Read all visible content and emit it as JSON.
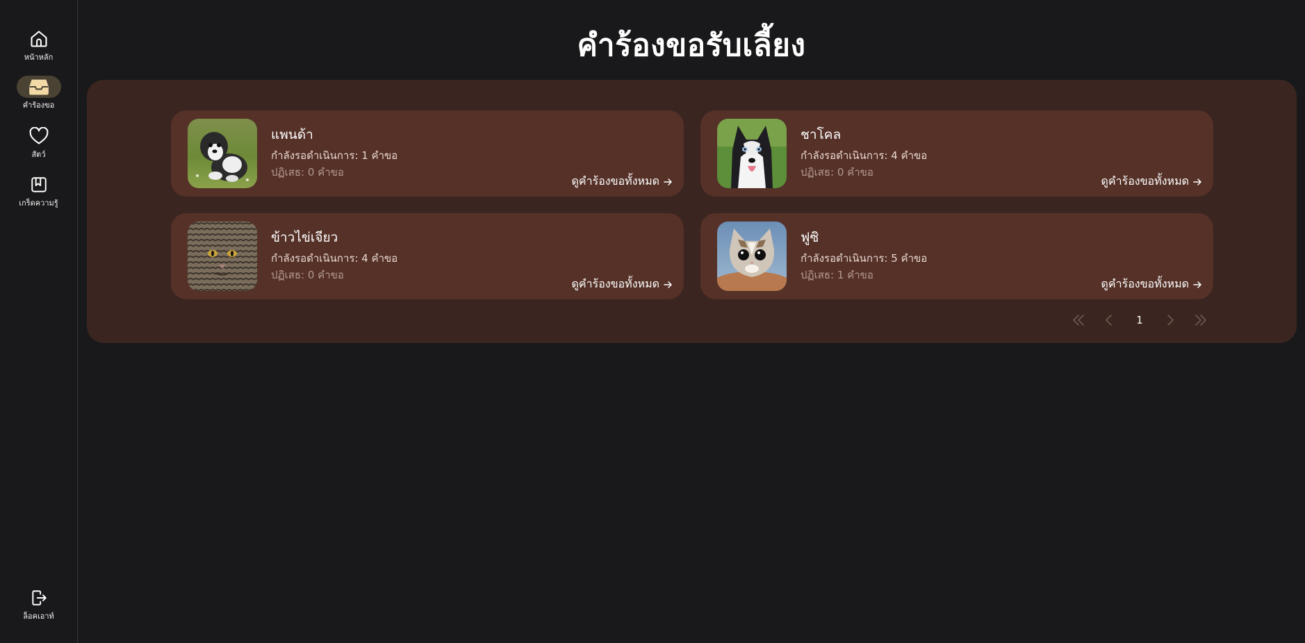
{
  "sidebar": {
    "items": [
      {
        "label": "หน้าหลัก",
        "icon": "home-icon",
        "active": false
      },
      {
        "label": "คำร้องขอ",
        "icon": "inbox-icon",
        "active": true
      },
      {
        "label": "สัตว์",
        "icon": "heart-icon",
        "active": false
      },
      {
        "label": "เกร็ดความรู้",
        "icon": "bookmark-icon",
        "active": false
      }
    ],
    "logout_label": "ล็อคเอาท์"
  },
  "page": {
    "title": "คำร้องขอรับเลี้ยง"
  },
  "cards": [
    {
      "name": "แพนด้า",
      "pending": "กำลังรอดำเนินการ: 1 คำขอ",
      "rejected": "ปฏิเสธ: 0 คำขอ",
      "link": "ดูคำร้องขอทั้งหมด",
      "image": "shih-tzu-dog-photo"
    },
    {
      "name": "ชาโคล",
      "pending": "กำลังรอดำเนินการ: 4 คำขอ",
      "rejected": "ปฏิเสธ: 0 คำขอ",
      "link": "ดูคำร้องขอทั้งหมด",
      "image": "husky-dog-photo"
    },
    {
      "name": "ข้าวไข่เจียว",
      "pending": "กำลังรอดำเนินการ: 4 คำขอ",
      "rejected": "ปฏิเสธ: 0 คำขอ",
      "link": "ดูคำร้องขอทั้งหมด",
      "image": "tabby-cat-photo"
    },
    {
      "name": "ฟูซิ",
      "pending": "กำลังรอดำเนินการ: 5 คำขอ",
      "rejected": "ปฏิเสธ: 1 คำขอ",
      "link": "ดูคำร้องขอทั้งหมด",
      "image": "kitten-photo"
    }
  ],
  "pagination": {
    "current_page": "1"
  },
  "colors": {
    "background": "#19191b",
    "panel": "#3a2520",
    "card": "#553128",
    "active_nav": "#4a4334",
    "active_icon": "#f3d9a6"
  }
}
